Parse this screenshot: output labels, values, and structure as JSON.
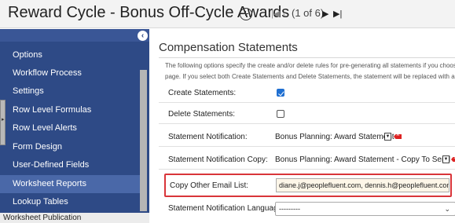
{
  "header": {
    "title": "Reward Cycle - Bonus Off-Cycle Awards",
    "pager": "(1 of 6)",
    "icons": [
      "plus-circle-icon",
      "first-page-icon",
      "previous-page-icon",
      "next-page-icon",
      "last-page-icon"
    ]
  },
  "sidebar": {
    "items": [
      {
        "label": "Options"
      },
      {
        "label": "Workflow Process"
      },
      {
        "label": "Settings"
      },
      {
        "label": "Row Level Formulas"
      },
      {
        "label": "Row Level Alerts"
      },
      {
        "label": "Form Design"
      },
      {
        "label": "User-Defined Fields"
      },
      {
        "label": "Worksheet Reports",
        "selected": true
      },
      {
        "label": "Lookup Tables"
      }
    ],
    "footer": "Worksheet Publication"
  },
  "main": {
    "title": "Compensation Statements",
    "description_line1": "The following options specify the create and/or delete rules for pre-generating all statements if you choos",
    "description_line2": "page. If you select both Create Statements and Delete Statements, the statement will be replaced with a n",
    "rows": {
      "create_label": "Create Statements:",
      "create_checked": true,
      "delete_label": "Delete Statements:",
      "delete_checked": false,
      "notification_label": "Statement Notification:",
      "notification_value": "Bonus Planning: Award Statement",
      "notification_copy_label": "Statement Notification Copy:",
      "notification_copy_value": "Bonus Planning: Award Statement - Copy To Send",
      "email_label": "Copy Other Email List:",
      "email_value": "diane.j@peoplefluent.com, dennis.h@peoplefluent.com",
      "language_label": "Statement Notification Language:",
      "language_value": "---------"
    }
  },
  "colors": {
    "sidebar_bg": "#2e4a86",
    "sidebar_selected": "#4a68a8",
    "highlight_border": "#d9353a",
    "delete_icon": "#dd2222",
    "checkbox_checked": "#1f6fd1"
  }
}
